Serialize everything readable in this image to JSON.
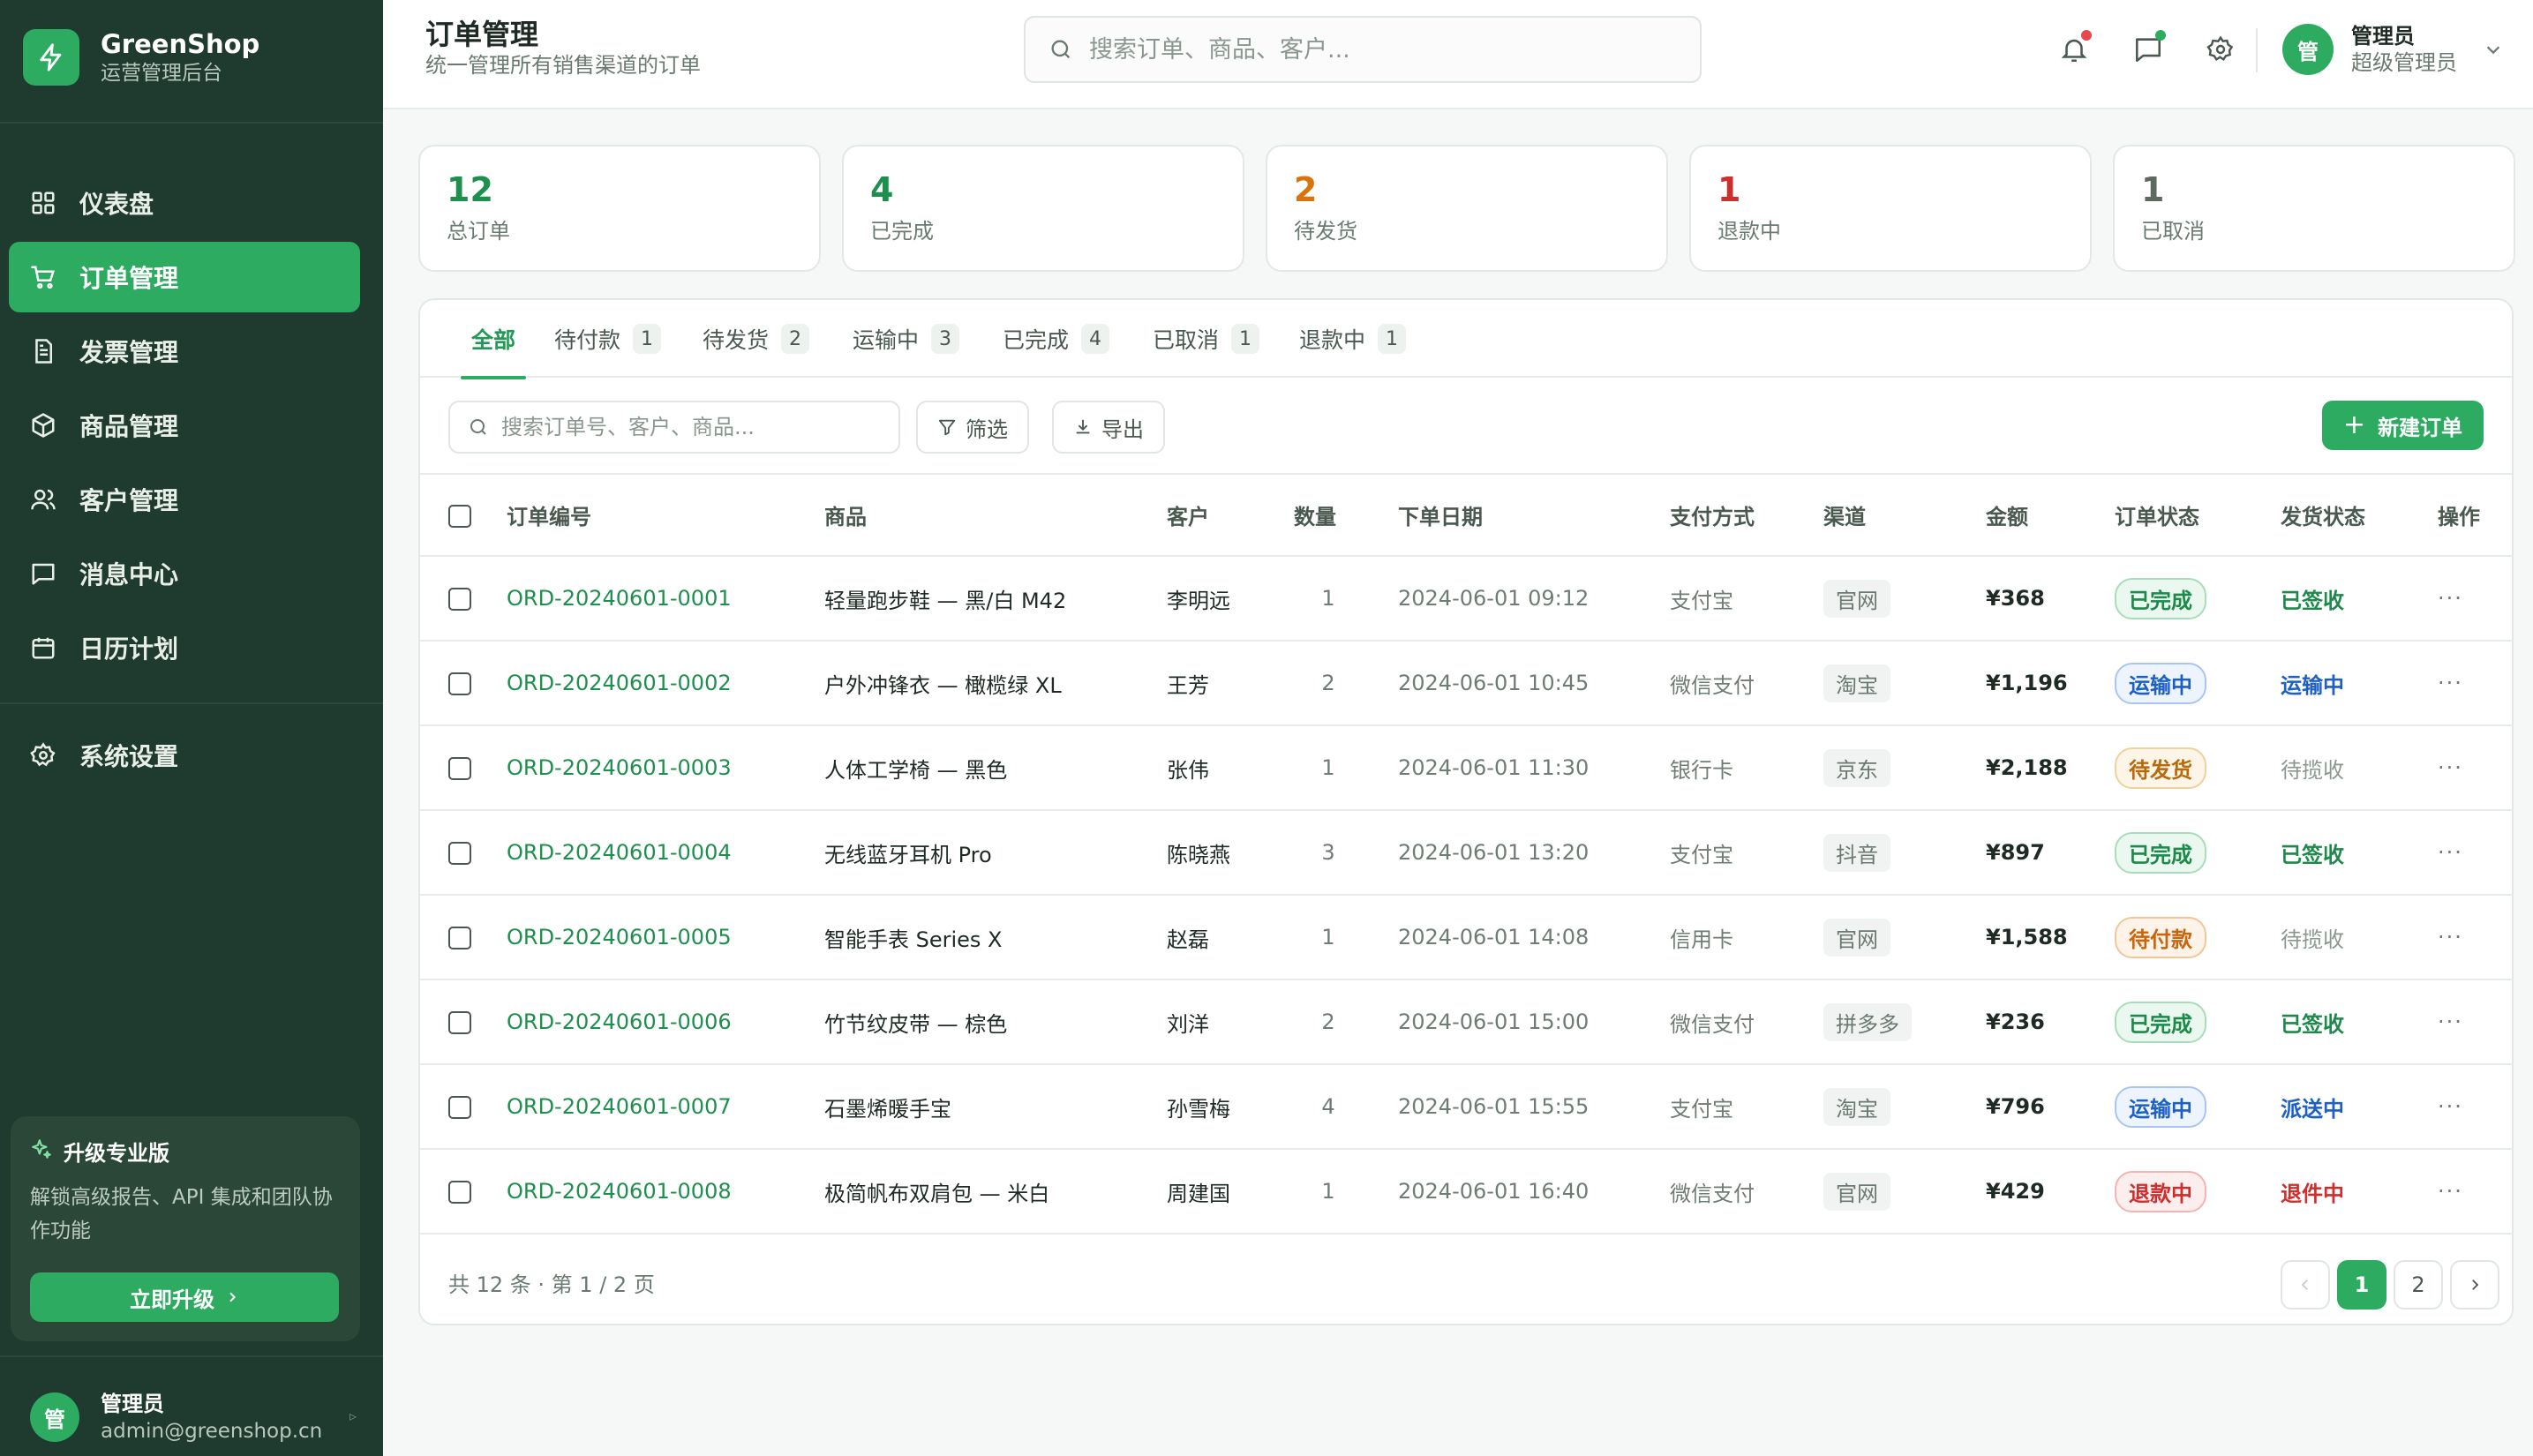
{
  "brand": {
    "name": "GreenShop",
    "subtitle": "运营管理后台"
  },
  "sidebar": {
    "items": [
      {
        "label": "仪表盘",
        "icon": "dashboard-icon"
      },
      {
        "label": "订单管理",
        "icon": "cart-icon",
        "active": true
      },
      {
        "label": "发票管理",
        "icon": "invoice-icon"
      },
      {
        "label": "商品管理",
        "icon": "box-icon"
      },
      {
        "label": "客户管理",
        "icon": "users-icon"
      },
      {
        "label": "消息中心",
        "icon": "message-icon"
      },
      {
        "label": "日历计划",
        "icon": "calendar-icon"
      }
    ],
    "settings": {
      "label": "系统设置",
      "icon": "gear-icon"
    },
    "upgrade": {
      "title": "升级专业版",
      "desc": "解锁高级报告、API 集成和团队协作功能",
      "button": "立即升级"
    },
    "user": {
      "avatar": "管",
      "name": "管理员",
      "email": "admin@greenshop.cn"
    }
  },
  "header": {
    "title": "订单管理",
    "subtitle": "统一管理所有销售渠道的订单",
    "search_placeholder": "搜索订单、商品、客户...",
    "user": {
      "avatar": "管",
      "name": "管理员",
      "role": "超级管理员"
    }
  },
  "stats": [
    {
      "value": "12",
      "label": "总订单",
      "color": "#1f8f4e"
    },
    {
      "value": "4",
      "label": "已完成",
      "color": "#1f8f4e"
    },
    {
      "value": "2",
      "label": "待发货",
      "color": "#d9730d"
    },
    {
      "value": "1",
      "label": "退款中",
      "color": "#d02d2d"
    },
    {
      "value": "1",
      "label": "已取消",
      "color": "#5d6a62"
    }
  ],
  "tabs": [
    {
      "label": "全部",
      "count": ""
    },
    {
      "label": "待付款",
      "count": "1"
    },
    {
      "label": "待发货",
      "count": "2"
    },
    {
      "label": "运输中",
      "count": "3"
    },
    {
      "label": "已完成",
      "count": "4"
    },
    {
      "label": "已取消",
      "count": "1"
    },
    {
      "label": "退款中",
      "count": "1"
    }
  ],
  "toolbar": {
    "search_placeholder": "搜索订单号、客户、商品...",
    "filter_label": "筛选",
    "export_label": "导出",
    "new_label": "新建订单"
  },
  "table": {
    "columns": [
      "订单编号",
      "商品",
      "客户",
      "数量",
      "下单日期",
      "支付方式",
      "渠道",
      "金额",
      "订单状态",
      "发货状态",
      "操作"
    ],
    "rows": [
      {
        "id": "ORD-20240601-0001",
        "product": "轻量跑步鞋 — 黑/白 M42",
        "customer": "李明远",
        "qty": "1",
        "date": "2024-06-01 09:12",
        "payment": "支付宝",
        "channel": "官网",
        "amount": "¥368",
        "status": "已完成",
        "status_type": "done",
        "delivery": "已签收",
        "delivery_type": "green",
        "action": "···"
      },
      {
        "id": "ORD-20240601-0002",
        "product": "户外冲锋衣 — 橄榄绿 XL",
        "customer": "王芳",
        "qty": "2",
        "date": "2024-06-01 10:45",
        "payment": "微信支付",
        "channel": "淘宝",
        "amount": "¥1,196",
        "status": "运输中",
        "status_type": "ship",
        "delivery": "运输中",
        "delivery_type": "blue",
        "action": "···"
      },
      {
        "id": "ORD-20240601-0003",
        "product": "人体工学椅 — 黑色",
        "customer": "张伟",
        "qty": "1",
        "date": "2024-06-01 11:30",
        "payment": "银行卡",
        "channel": "京东",
        "amount": "¥2,188",
        "status": "待发货",
        "status_type": "wait",
        "delivery": "待揽收",
        "delivery_type": "gray",
        "action": "···"
      },
      {
        "id": "ORD-20240601-0004",
        "product": "无线蓝牙耳机 Pro",
        "customer": "陈晓燕",
        "qty": "3",
        "date": "2024-06-01 13:20",
        "payment": "支付宝",
        "channel": "抖音",
        "amount": "¥897",
        "status": "已完成",
        "status_type": "done",
        "delivery": "已签收",
        "delivery_type": "green",
        "action": "···"
      },
      {
        "id": "ORD-20240601-0005",
        "product": "智能手表 Series X",
        "customer": "赵磊",
        "qty": "1",
        "date": "2024-06-01 14:08",
        "payment": "信用卡",
        "channel": "官网",
        "amount": "¥1,588",
        "status": "待付款",
        "status_type": "pay",
        "delivery": "待揽收",
        "delivery_type": "gray",
        "action": "···"
      },
      {
        "id": "ORD-20240601-0006",
        "product": "竹节纹皮带 — 棕色",
        "customer": "刘洋",
        "qty": "2",
        "date": "2024-06-01 15:00",
        "payment": "微信支付",
        "channel": "拼多多",
        "amount": "¥236",
        "status": "已完成",
        "status_type": "done",
        "delivery": "已签收",
        "delivery_type": "green",
        "action": "···"
      },
      {
        "id": "ORD-20240601-0007",
        "product": "石墨烯暖手宝",
        "customer": "孙雪梅",
        "qty": "4",
        "date": "2024-06-01 15:55",
        "payment": "支付宝",
        "channel": "淘宝",
        "amount": "¥796",
        "status": "运输中",
        "status_type": "ship",
        "delivery": "派送中",
        "delivery_type": "blue",
        "action": "···"
      },
      {
        "id": "ORD-20240601-0008",
        "product": "极简帆布双肩包 — 米白",
        "customer": "周建国",
        "qty": "1",
        "date": "2024-06-01 16:40",
        "payment": "微信支付",
        "channel": "官网",
        "amount": "¥429",
        "status": "退款中",
        "status_type": "refund",
        "delivery": "退件中",
        "delivery_type": "red",
        "action": "···"
      }
    ]
  },
  "pagination": {
    "info": "共 12 条 · 第 1 / 2 页",
    "pages": [
      "1",
      "2"
    ],
    "current": "1"
  },
  "colors": {
    "accent": "#2cab61",
    "sidebar_bg": "#1f3a2e"
  }
}
